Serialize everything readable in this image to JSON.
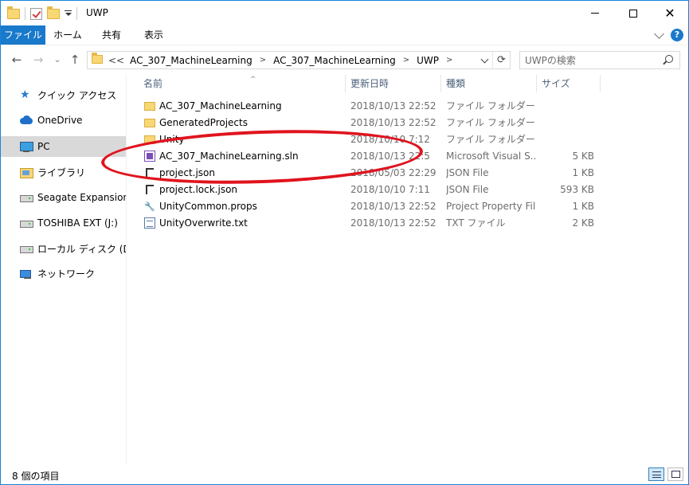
{
  "window": {
    "title": "UWP",
    "controls": {
      "minimize": "—",
      "maximize": "☐",
      "close": "✕"
    }
  },
  "ribbon": {
    "tabs": [
      "ファイル",
      "ホーム",
      "共有",
      "表示"
    ],
    "help": "?"
  },
  "navigation": {
    "back": "←",
    "forward": "→",
    "recent": "⌄",
    "up": "↑",
    "breadcrumb_lead": "<<",
    "breadcrumb": [
      "AC_307_MachineLearning",
      "AC_307_MachineLearning",
      "UWP"
    ],
    "crumb_separator": ">",
    "refresh": "⟳",
    "search_placeholder": "UWPの検索"
  },
  "sidebar": {
    "items": [
      {
        "label": "クイック アクセス",
        "icon": "quick-access-star-icon"
      },
      {
        "label": "OneDrive",
        "icon": "onedrive-cloud-icon"
      },
      {
        "label": "PC",
        "icon": "pc-icon",
        "selected": true
      },
      {
        "label": "ライブラリ",
        "icon": "library-icon"
      },
      {
        "label": "Seagate Expansion Dr",
        "icon": "drive-icon"
      },
      {
        "label": "TOSHIBA EXT (J:)",
        "icon": "drive-icon"
      },
      {
        "label": "ローカル ディスク (D:)",
        "icon": "drive-icon"
      },
      {
        "label": "ネットワーク",
        "icon": "network-icon"
      }
    ]
  },
  "file_list": {
    "columns": [
      "名前",
      "更新日時",
      "種類",
      "サイズ"
    ],
    "sort_indicator": "^",
    "rows": [
      {
        "name": "AC_307_MachineLearning",
        "date": "2018/10/13 22:52",
        "type": "ファイル フォルダー",
        "size": "",
        "icon": "folder"
      },
      {
        "name": "GeneratedProjects",
        "date": "2018/10/13 22:52",
        "type": "ファイル フォルダー",
        "size": "",
        "icon": "folder"
      },
      {
        "name": "Unity",
        "date": "2018/10/10 7:12",
        "type": "ファイル フォルダー",
        "size": "",
        "icon": "folder"
      },
      {
        "name": "AC_307_MachineLearning.sln",
        "date": "2018/10/13 22:5",
        "type": "Microsoft Visual S...",
        "size": "5 KB",
        "icon": "sln"
      },
      {
        "name": "project.json",
        "date": "2018/05/03 22:29",
        "type": "JSON File",
        "size": "1 KB",
        "icon": "json"
      },
      {
        "name": "project.lock.json",
        "date": "2018/10/10 7:11",
        "type": "JSON File",
        "size": "593 KB",
        "icon": "json"
      },
      {
        "name": "UnityCommon.props",
        "date": "2018/10/13 22:52",
        "type": "Project Property File",
        "size": "1 KB",
        "icon": "props"
      },
      {
        "name": "UnityOverwrite.txt",
        "date": "2018/10/13 22:52",
        "type": "TXT ファイル",
        "size": "2 KB",
        "icon": "txt"
      }
    ]
  },
  "status": {
    "item_count": "8 個の項目"
  },
  "colors": {
    "accent": "#1979ca",
    "annotation": "#e0141e",
    "selected": "#d9d9d9"
  }
}
